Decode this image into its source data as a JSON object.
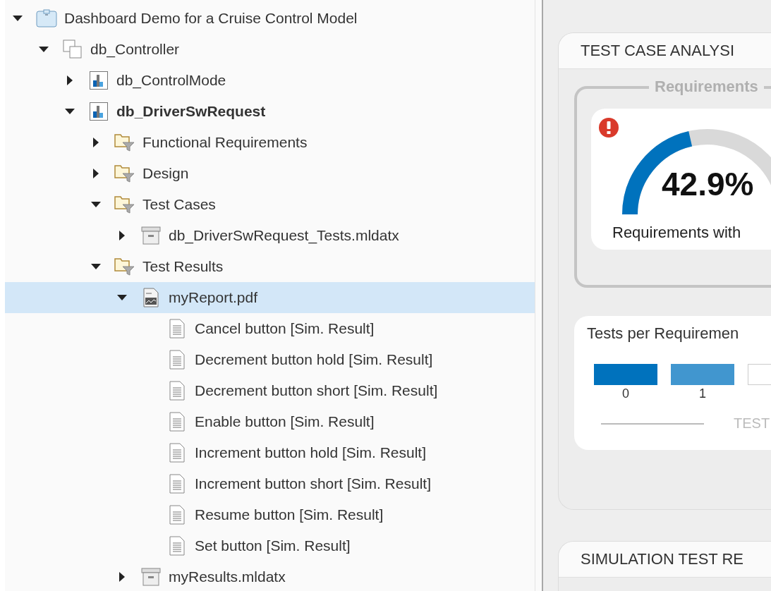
{
  "tree": [
    {
      "label": "Dashboard Demo for a Cruise Control Model",
      "kind": "project",
      "expanded": true,
      "selected": false,
      "bold": false,
      "children": [
        {
          "label": "db_Controller",
          "kind": "component",
          "expanded": true,
          "selected": false,
          "bold": false,
          "children": [
            {
              "label": "db_ControlMode",
              "kind": "model",
              "expanded": false,
              "selected": false,
              "bold": false
            },
            {
              "label": "db_DriverSwRequest",
              "kind": "model",
              "expanded": true,
              "selected": false,
              "bold": true,
              "children": [
                {
                  "label": "Functional Requirements",
                  "kind": "folder",
                  "expanded": false,
                  "selected": false,
                  "bold": false
                },
                {
                  "label": "Design",
                  "kind": "folder",
                  "expanded": false,
                  "selected": false,
                  "bold": false
                },
                {
                  "label": "Test Cases",
                  "kind": "folder",
                  "expanded": true,
                  "selected": false,
                  "bold": false,
                  "children": [
                    {
                      "label": "db_DriverSwRequest_Tests.mldatx",
                      "kind": "archive",
                      "expanded": false,
                      "selected": false,
                      "bold": false
                    }
                  ]
                },
                {
                  "label": "Test Results",
                  "kind": "folder",
                  "expanded": true,
                  "selected": false,
                  "bold": false,
                  "children": [
                    {
                      "label": "myReport.pdf",
                      "kind": "report",
                      "expanded": true,
                      "selected": true,
                      "bold": false,
                      "children": [
                        {
                          "label": "Cancel button [Sim. Result]",
                          "kind": "result",
                          "selected": false,
                          "bold": false
                        },
                        {
                          "label": "Decrement button hold [Sim. Result]",
                          "kind": "result",
                          "selected": false,
                          "bold": false
                        },
                        {
                          "label": "Decrement button short [Sim. Result]",
                          "kind": "result",
                          "selected": false,
                          "bold": false
                        },
                        {
                          "label": "Enable button [Sim. Result]",
                          "kind": "result",
                          "selected": false,
                          "bold": false
                        },
                        {
                          "label": "Increment button hold [Sim. Result]",
                          "kind": "result",
                          "selected": false,
                          "bold": false
                        },
                        {
                          "label": "Increment button short [Sim. Result]",
                          "kind": "result",
                          "selected": false,
                          "bold": false
                        },
                        {
                          "label": "Resume button [Sim. Result]",
                          "kind": "result",
                          "selected": false,
                          "bold": false
                        },
                        {
                          "label": "Set button [Sim. Result]",
                          "kind": "result",
                          "selected": false,
                          "bold": false
                        }
                      ]
                    },
                    {
                      "label": "myResults.mldatx",
                      "kind": "archive",
                      "expanded": false,
                      "selected": false,
                      "bold": false
                    }
                  ]
                }
              ]
            }
          ]
        }
      ]
    }
  ],
  "test_case_analysis": {
    "title": "TEST CASE ANALYSI",
    "requirements_group": {
      "title": "Requirements",
      "gauge": {
        "alert": true,
        "level": 0.429,
        "value": "42.9%",
        "caption": "Requirements with"
      }
    },
    "tests_per_requirement": {
      "title": "Tests per Requiremen",
      "legend": "TEST",
      "segments": [
        {
          "label": "0",
          "color": "#0072bd"
        },
        {
          "label": "1",
          "color": "#4196cf"
        },
        {
          "color": "#ffffff"
        }
      ]
    }
  },
  "simulation_test_results": {
    "title": "SIMULATION TEST RE"
  }
}
